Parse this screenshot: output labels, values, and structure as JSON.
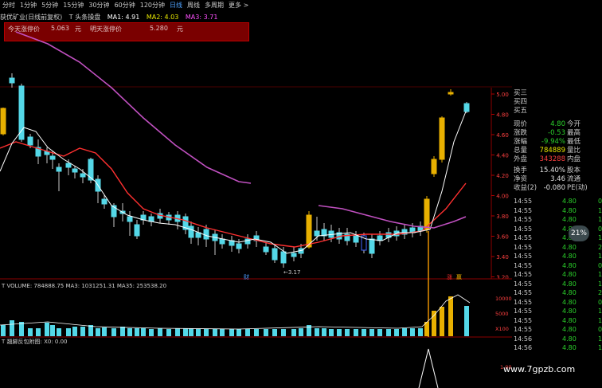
{
  "toolbar": {
    "items": [
      "分时",
      "1分钟",
      "5分钟",
      "15分钟",
      "30分钟",
      "60分钟",
      "120分钟",
      "日线",
      "周线",
      "多周期",
      "更多 >"
    ],
    "active_index": 7
  },
  "title": {
    "name": "获优矿业(日线前复权)",
    "indicator": "T 头条操盘",
    "ma1": "MA1: 4.91",
    "ma2": "MA2: 4.03",
    "ma3": "MA3: 3.71"
  },
  "price_bar": {
    "today_label": "今天涨停价",
    "today_value": "5.063",
    "unit1": "元",
    "tomorrow_label": "明天涨停价",
    "tomorrow_value": "5.280",
    "unit2": "元"
  },
  "price_axis": [
    "5.00",
    "4.80",
    "4.60",
    "4.40",
    "4.20",
    "4.00",
    "3.80",
    "3.60",
    "3.40",
    "3.20"
  ],
  "chart_labels": {
    "low_marker": "←3.17",
    "cai_marker": "财",
    "signal_1": "涨",
    "signal_2": "赢"
  },
  "volume": {
    "label": "T VOLUME: 784888.75  MA3: 1031251.31  MA35: 253538.20",
    "axis": [
      "10000",
      "5000",
      "X100"
    ]
  },
  "sub_indicator": {
    "label": "T 翘脚反包附图: X0: 0.00",
    "axis": "1.00"
  },
  "right_panel": {
    "orderbook": [
      {
        "label": "买三"
      },
      {
        "label": "买四"
      },
      {
        "label": "买五"
      }
    ],
    "quote": [
      {
        "l1": "现价",
        "v": "4.80",
        "c": "#2bd12b",
        "l2": "今开"
      },
      {
        "l1": "涨跌",
        "v": "-0.53",
        "c": "#2bd12b",
        "l2": "最高"
      },
      {
        "l1": "涨幅",
        "v": "-9.94%",
        "c": "#2bd12b",
        "l2": "最低"
      },
      {
        "l1": "总量",
        "v": "784889",
        "c": "#e8e800",
        "l2": "量比"
      },
      {
        "l1": "外盘",
        "v": "343288",
        "c": "#ff4040",
        "l2": "内盘"
      }
    ],
    "stats": [
      {
        "l1": "换手",
        "v": "15.40%",
        "l2": "股本"
      },
      {
        "l1": "净资",
        "v": "3.46",
        "l2": "流通"
      },
      {
        "l1": "收益(2)",
        "v": "-0.080",
        "l2": "PE(动)"
      }
    ],
    "ticks": [
      {
        "t": "14:55",
        "p": "4.80",
        "v": "0"
      },
      {
        "t": "14:55",
        "p": "4.80",
        "v": "1"
      },
      {
        "t": "14:55",
        "p": "4.80",
        "v": "1"
      },
      {
        "t": "14:55",
        "p": "4.80",
        "v": "0"
      },
      {
        "t": "14:55",
        "p": "4.80",
        "v": "1"
      },
      {
        "t": "14:55",
        "p": "4.80",
        "v": "2"
      },
      {
        "t": "14:55",
        "p": "4.80",
        "v": "1"
      },
      {
        "t": "14:55",
        "p": "4.80",
        "v": "0"
      },
      {
        "t": "14:55",
        "p": "4.80",
        "v": "1"
      },
      {
        "t": "14:55",
        "p": "4.80",
        "v": "1"
      },
      {
        "t": "14:55",
        "p": "4.80",
        "v": "2"
      },
      {
        "t": "14:55",
        "p": "4.80",
        "v": "0"
      },
      {
        "t": "14:55",
        "p": "4.80",
        "v": "1"
      },
      {
        "t": "14:55",
        "p": "4.80",
        "v": "1"
      },
      {
        "t": "14:55",
        "p": "4.80",
        "v": "0"
      },
      {
        "t": "14:56",
        "p": "4.80",
        "v": "1"
      },
      {
        "t": "14:56",
        "p": "4.80",
        "v": "1"
      }
    ],
    "badge": "21%"
  },
  "watermark": "www.7gpzb.com"
}
